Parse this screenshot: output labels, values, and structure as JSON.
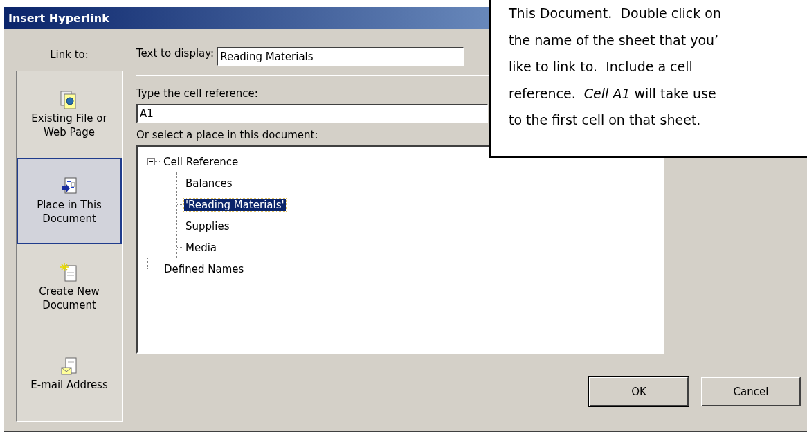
{
  "window": {
    "title": "Insert Hyperlink"
  },
  "link_to": {
    "label": "Link to:",
    "items": [
      {
        "kind": "file",
        "label": "Existing File or Web Page",
        "selected": false
      },
      {
        "kind": "place",
        "label": "Place in This Document",
        "selected": true
      },
      {
        "kind": "new",
        "label": "Create New Document",
        "selected": false
      },
      {
        "kind": "email",
        "label": "E-mail Address",
        "selected": false
      }
    ]
  },
  "text_to_display": {
    "label": "Text to display:",
    "value": "Reading Materials"
  },
  "cell_reference": {
    "label": "Type the cell reference:",
    "value": "A1"
  },
  "place_tree": {
    "label": "Or select a place in this document:",
    "items": [
      {
        "label": "Cell Reference",
        "expanded": true,
        "selected": false,
        "children": [
          {
            "label": "Balances",
            "selected": false
          },
          {
            "label": "'Reading Materials'",
            "selected": true
          },
          {
            "label": "Supplies",
            "selected": false
          },
          {
            "label": "Media",
            "selected": false
          }
        ]
      },
      {
        "label": "Defined Names",
        "selected": false
      }
    ]
  },
  "buttons": [
    {
      "label": "OK",
      "default": true
    },
    {
      "label": "Cancel",
      "default": false
    }
  ],
  "callout": {
    "lines": [
      "This Document.  Double click on",
      "the name of the sheet that you’",
      "like to link to.  Include a cell",
      "reference.  *Cell A1* will take use",
      "to the first cell on that sheet."
    ]
  }
}
